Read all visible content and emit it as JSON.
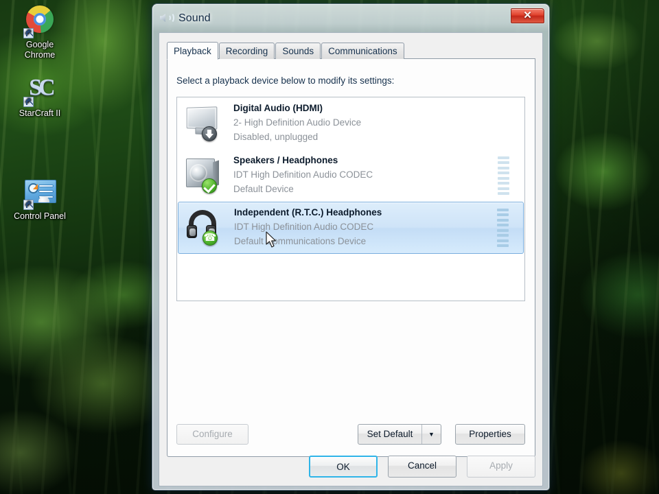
{
  "desktop": {
    "icons": [
      {
        "label": "Google\nChrome",
        "name": "google-chrome",
        "icon": "chrome-logo-icon"
      },
      {
        "label": "StarCraft II",
        "name": "starcraft-ii",
        "icon": "starcraft-logo-icon"
      },
      {
        "label": "Control Panel",
        "name": "control-panel",
        "icon": "control-panel-icon"
      }
    ],
    "labels": {
      "chrome_line1": "Google",
      "chrome_line2": "Chrome",
      "starcraft": "StarCraft II",
      "control_panel": "Control Panel"
    }
  },
  "dialog": {
    "title": "Sound",
    "title_icon": "sound-speaker-icon",
    "close_label": "✕",
    "tabs": [
      {
        "label": "Playback",
        "active": true
      },
      {
        "label": "Recording",
        "active": false
      },
      {
        "label": "Sounds",
        "active": false
      },
      {
        "label": "Communications",
        "active": false
      }
    ],
    "instruction": "Select a playback device below to modify its settings:",
    "devices": [
      {
        "name": "Digital Audio (HDMI)",
        "driver": "2- High Definition Audio Device",
        "status": "Disabled, unplugged",
        "icon": "monitor-icon",
        "badge": "down-arrow-badge",
        "selected": false,
        "meter_visible": false
      },
      {
        "name": "Speakers / Headphones",
        "driver": "IDT High Definition Audio CODEC",
        "status": "Default Device",
        "icon": "speaker-icon",
        "badge": "green-check-badge",
        "selected": false,
        "meter_visible": true
      },
      {
        "name": "Independent (R.T.C.) Headphones",
        "driver": "IDT High Definition Audio CODEC",
        "status": "Default Communications Device",
        "icon": "headphones-icon",
        "badge": "green-phone-badge",
        "selected": true,
        "meter_visible": true
      }
    ],
    "buttons": {
      "configure": "Configure",
      "set_default": "Set Default",
      "set_default_arrow": "▼",
      "properties": "Properties",
      "ok": "OK",
      "cancel": "Cancel",
      "apply": "Apply"
    }
  },
  "colors": {
    "selection_border": "#7aaede",
    "selection_fill": "#cfe4f8",
    "close_button": "#c4281a",
    "focus_ring": "#2eb4e8",
    "green_badge": "#4cb02a",
    "disabled_text": "#a6abb0",
    "sub_text": "#8b9198"
  }
}
